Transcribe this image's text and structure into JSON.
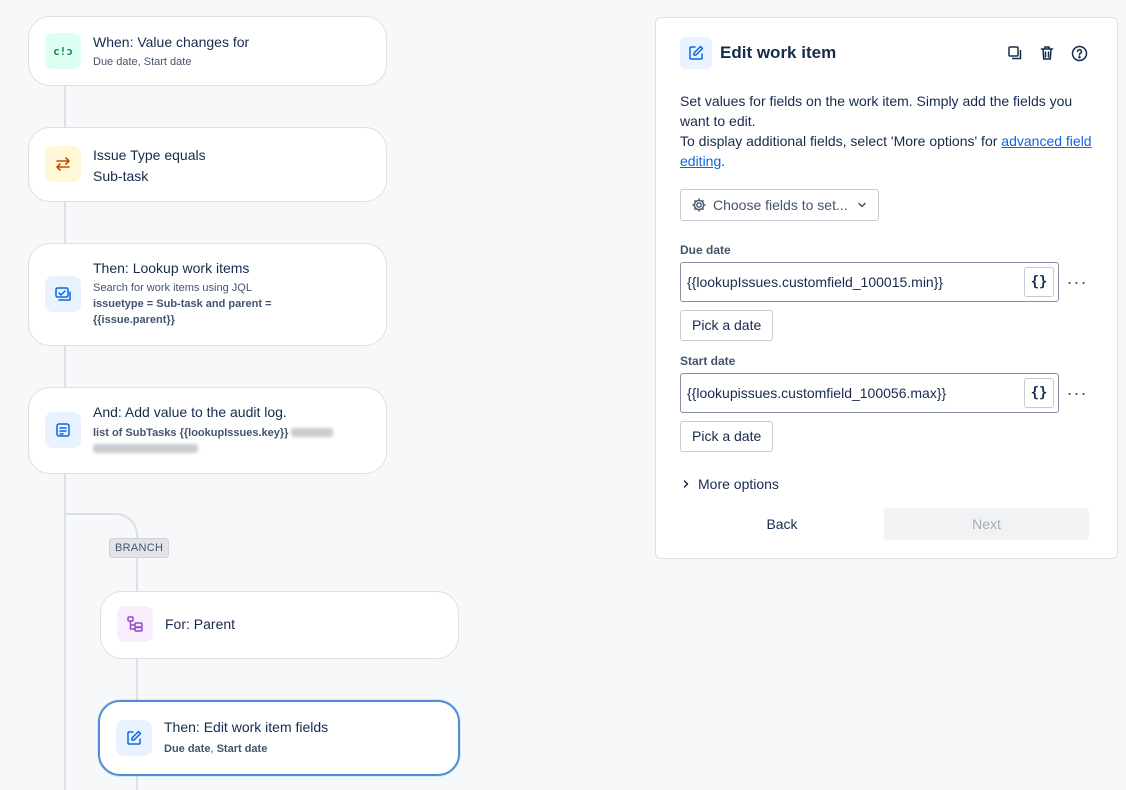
{
  "flow": {
    "trigger": {
      "title": "When: Value changes for",
      "subtitle": "Due date, Start date"
    },
    "condition": {
      "title": "Issue Type equals",
      "subtitle": "Sub-task"
    },
    "lookup": {
      "title": "Then: Lookup work items",
      "subtitle": "Search for work items using JQL",
      "jql_line1": "issuetype = Sub-task and parent =",
      "jql_line2": "{{issue.parent}}"
    },
    "audit": {
      "title": "And: Add value to the audit log.",
      "detail": "list of SubTasks {{lookupIssues.key}}"
    },
    "branch_tag": "BRANCH",
    "for_parent": {
      "title": "For: Parent"
    },
    "edit_fields": {
      "title": "Then: Edit work item fields",
      "detail_a": "Due date",
      "detail_sep": ",",
      "detail_b": "Start date"
    }
  },
  "panel": {
    "title": "Edit work item",
    "desc_line1": "Set values for fields on the work item. Simply add the fields you want to edit.",
    "desc_line2": "To display additional fields, select 'More options' for",
    "desc_link": "advanced field editing",
    "desc_end": ".",
    "choose_fields": "Choose fields to set...",
    "fields": [
      {
        "label": "Due date",
        "value": "{{lookupIssues.customfield_100015.min}}",
        "brace": "{}",
        "pick": "Pick a date"
      },
      {
        "label": "Start date",
        "value": "{{lookupissues.customfield_100056.max}}",
        "brace": "{}",
        "pick": "Pick a date"
      }
    ],
    "more_options": "More options",
    "back": "Back",
    "next": "Next"
  },
  "icons": {
    "trigger": "value-change-icon",
    "condition": "swap-icon",
    "lookup": "lookup-icon",
    "audit": "log-icon",
    "for_parent": "hierarchy-icon",
    "edit": "edit-icon"
  },
  "colors": {
    "accent": "#0c66e4",
    "selected_border": "#4c8fd6"
  }
}
